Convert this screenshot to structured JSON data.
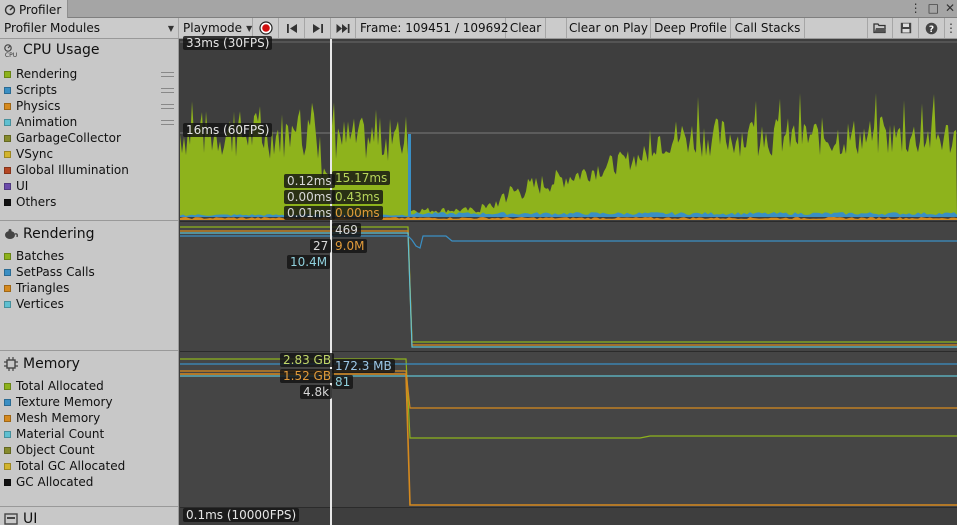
{
  "window": {
    "tab_title": "Profiler",
    "tab_icon": "profiler-icon",
    "controls": [
      "kebab-menu-icon",
      "maximize-icon",
      "close-icon"
    ]
  },
  "toolbar": {
    "modules_dropdown": "Profiler Modules",
    "target_dropdown": "Playmode",
    "record_icon": "record-icon",
    "first_frame_icon": "step-back-icon",
    "next_frame_icon": "step-forward-icon",
    "last_frame_icon": "skip-to-end-icon",
    "frame_label": "Frame: 109451 / 109692",
    "clear": "Clear",
    "clear_on_play": "Clear on Play",
    "deep_profile": "Deep Profile",
    "call_stacks": "Call Stacks",
    "load_icon": "open-folder-icon",
    "save_icon": "save-icon",
    "help_icon": "help-icon"
  },
  "modules": {
    "cpu": {
      "title": "CPU Usage",
      "icon": "cpu-icon",
      "items": [
        {
          "label": "Rendering",
          "color": "#8eb31c"
        },
        {
          "label": "Scripts",
          "color": "#3a8fc4"
        },
        {
          "label": "Physics",
          "color": "#d68a1e"
        },
        {
          "label": "Animation",
          "color": "#5fc0d1"
        },
        {
          "label": "GarbageCollector",
          "color": "#868b2c"
        },
        {
          "label": "VSync",
          "color": "#d2b42d"
        },
        {
          "label": "Global Illumination",
          "color": "#b54623"
        },
        {
          "label": "UI",
          "color": "#6b4bab"
        },
        {
          "label": "Others",
          "color": "#111111"
        }
      ],
      "ref_lines": [
        "33ms (30FPS)",
        "16ms (60FPS)"
      ],
      "left_values": [
        "0.12ms",
        "0.00ms",
        "0.01ms"
      ],
      "right_values": [
        "15.17ms",
        "0.43ms",
        "0.00ms"
      ]
    },
    "rendering": {
      "title": "Rendering",
      "icon": "teapot-icon",
      "items": [
        {
          "label": "Batches",
          "color": "#8eb31c"
        },
        {
          "label": "SetPass Calls",
          "color": "#3a8fc4"
        },
        {
          "label": "Triangles",
          "color": "#d68a1e"
        },
        {
          "label": "Vertices",
          "color": "#5fc0d1"
        }
      ],
      "values": [
        "469",
        "27",
        "9.0M",
        "10.4M"
      ]
    },
    "memory": {
      "title": "Memory",
      "icon": "chip-icon",
      "items": [
        {
          "label": "Total Allocated",
          "color": "#8eb31c"
        },
        {
          "label": "Texture Memory",
          "color": "#3a8fc4"
        },
        {
          "label": "Mesh Memory",
          "color": "#d68a1e"
        },
        {
          "label": "Material Count",
          "color": "#5fc0d1"
        },
        {
          "label": "Object Count",
          "color": "#868b2c"
        },
        {
          "label": "Total GC Allocated",
          "color": "#d2b42d"
        },
        {
          "label": "GC Allocated",
          "color": "#111111"
        }
      ],
      "values": [
        "2.83 GB",
        "172.3 MB",
        "1.52 GB",
        "81",
        "4.8k"
      ]
    },
    "ui": {
      "title": "UI",
      "icon": "ui-icon",
      "ref_line": "0.1ms (10000FPS)"
    }
  }
}
